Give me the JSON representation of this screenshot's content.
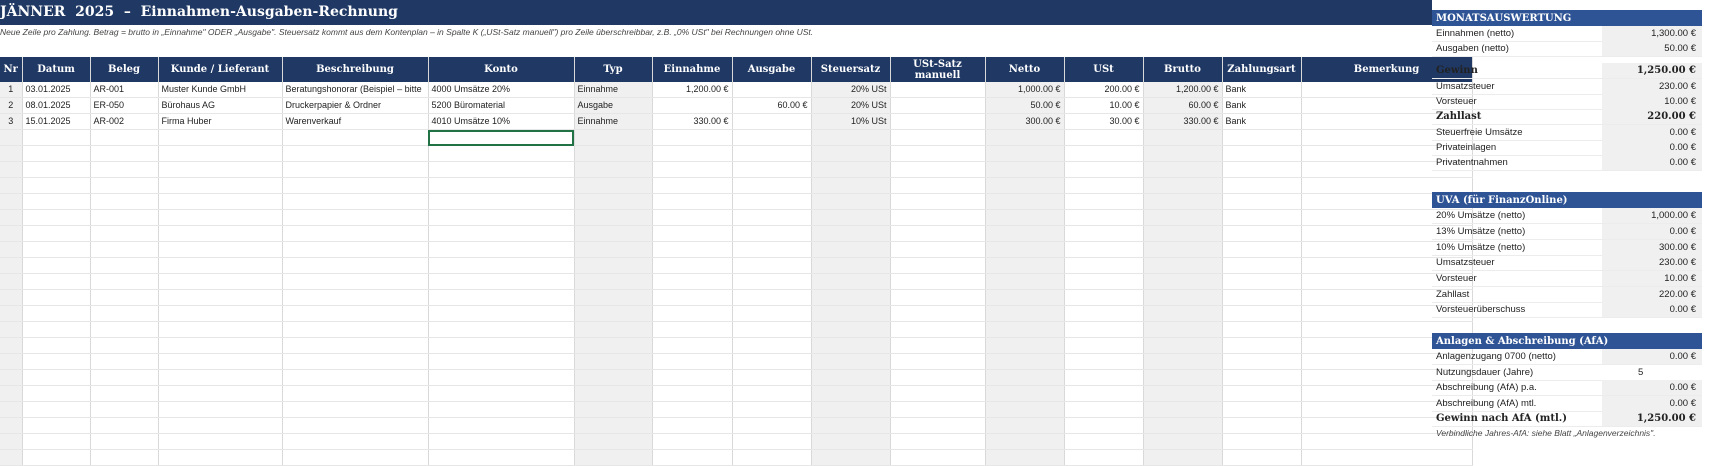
{
  "title": "JÄNNER  2025  –  Einnahmen-Ausgaben-Rechnung",
  "note": "Neue Zeile pro Zahlung. Betrag = brutto in „Einnahme\" ODER „Ausgabe\". Steuersatz kommt aus dem Kontenplan – in Spalte K („USt-Satz manuell\") pro Zeile überschreibbar, z.B. „0% USt\" bei Rechnungen ohne USt.",
  "columns": [
    "Nr",
    "Datum",
    "Beleg",
    "Kunde / Lieferant",
    "Beschreibung",
    "Konto",
    "Typ",
    "Einnahme",
    "Ausgabe",
    "Steuersatz",
    "USt-Satz manuell",
    "Netto",
    "USt",
    "Brutto",
    "Zahlungsart",
    "Bemerkung"
  ],
  "rows": [
    [
      "1",
      "03.01.2025",
      "AR-001",
      "Muster Kunde GmbH",
      "Beratungshonorar (Beispiel – bitte",
      "4000 Umsätze 20%",
      "Einnahme",
      "1,200.00 €",
      "",
      "20% USt",
      "",
      "1,000.00 €",
      "200.00 €",
      "1,200.00 €",
      "Bank",
      ""
    ],
    [
      "2",
      "08.01.2025",
      "ER-050",
      "Bürohaus AG",
      "Druckerpapier & Ordner",
      "5200 Büromaterial",
      "Ausgabe",
      "",
      "60.00 €",
      "20% USt",
      "",
      "50.00 €",
      "10.00 €",
      "60.00 €",
      "Bank",
      ""
    ],
    [
      "3",
      "15.01.2025",
      "AR-002",
      "Firma Huber",
      "Warenverkauf",
      "4010 Umsätze 10%",
      "Einnahme",
      "330.00 €",
      "",
      "10% USt",
      "",
      "300.00 €",
      "30.00 €",
      "330.00 €",
      "Bank",
      ""
    ]
  ],
  "monat": {
    "heading": "MONATSAUSWERTUNG",
    "einnahmen_label": "Einnahmen (netto)",
    "einnahmen": "1,300.00 €",
    "ausgaben_label": "Ausgaben (netto)",
    "ausgaben": "50.00 €",
    "gewinn_label": "Gewinn",
    "gewinn": "1,250.00 €",
    "ust_label": "Umsatzsteuer",
    "ust": "230.00 €",
    "vst_label": "Vorsteuer",
    "vst": "10.00 €",
    "zahllast_label": "Zahllast",
    "zahllast": "220.00 €",
    "steuerfrei_label": "Steuerfreie Umsätze",
    "steuerfrei": "0.00 €",
    "einlagen_label": "Privateinlagen",
    "einlagen": "0.00 €",
    "entnahmen_label": "Privatentnahmen",
    "entnahmen": "0.00 €"
  },
  "uva": {
    "heading": "UVA (für FinanzOnline)",
    "u20_label": "20% Umsätze (netto)",
    "u20": "1,000.00 €",
    "u13_label": "13% Umsätze (netto)",
    "u13": "0.00 €",
    "u10_label": "10% Umsätze (netto)",
    "u10": "300.00 €",
    "ust_label": "Umsatzsteuer",
    "ust": "230.00 €",
    "vst_label": "Vorsteuer",
    "vst": "10.00 €",
    "zahllast_label": "Zahllast",
    "zahllast": "220.00 €",
    "ueber_label": "Vorsteuerüberschuss",
    "ueber": "0.00 €"
  },
  "afa": {
    "heading": "Anlagen & Abschreibung (AfA)",
    "zugang_label": "Anlagenzugang 0700 (netto)",
    "zugang": "0.00 €",
    "dauer_label": "Nutzungsdauer (Jahre)",
    "dauer": "5",
    "pa_label": "Abschreibung (AfA) p.a.",
    "pa": "0.00 €",
    "mtl_label": "Abschreibung (AfA) mtl.",
    "mtl": "0.00 €",
    "gewinn_label": "Gewinn nach AfA (mtl.)",
    "gewinn": "1,250.00 €",
    "footnote": "Verbindliche Jahres-AfA: siehe Blatt „Anlagenverzeichnis\"."
  }
}
